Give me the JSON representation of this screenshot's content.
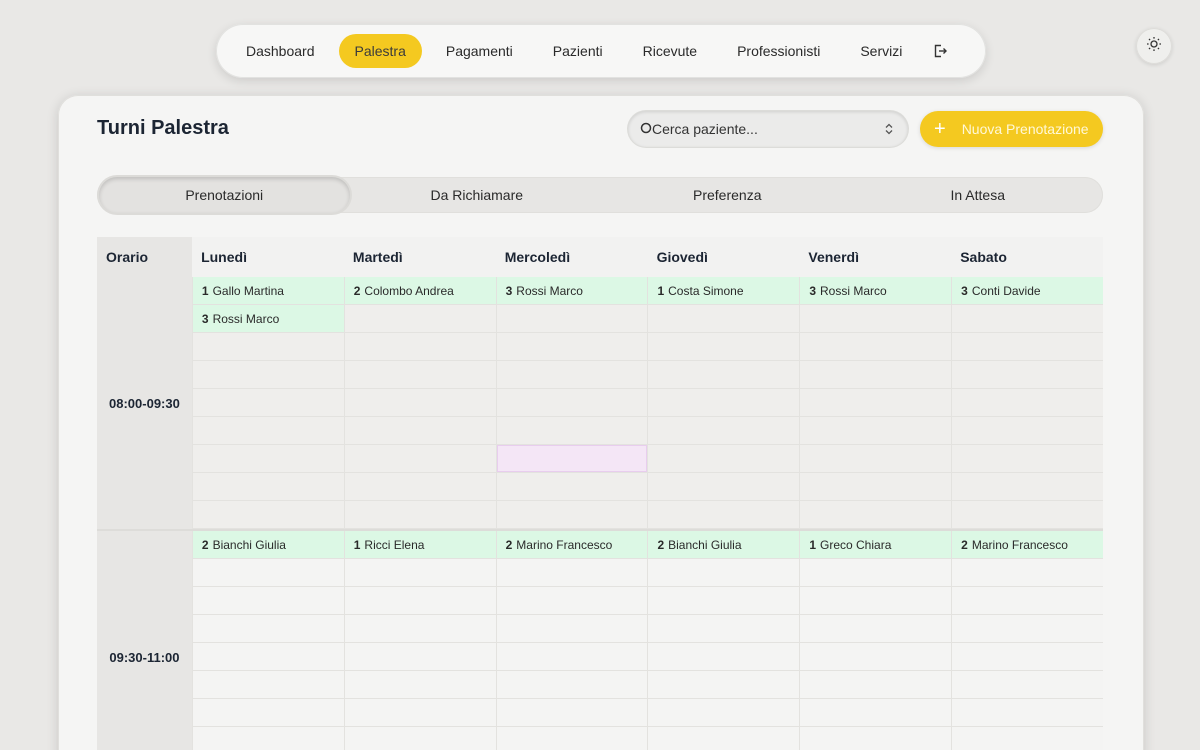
{
  "nav": {
    "items": [
      {
        "label": "Dashboard",
        "active": false
      },
      {
        "label": "Palestra",
        "active": true
      },
      {
        "label": "Pagamenti",
        "active": false
      },
      {
        "label": "Pazienti",
        "active": false
      },
      {
        "label": "Ricevute",
        "active": false
      },
      {
        "label": "Professionisti",
        "active": false
      },
      {
        "label": "Servizi",
        "active": false
      }
    ],
    "logout_icon": "logout-icon"
  },
  "theme_toggle_icon": "sun-icon",
  "page": {
    "title": "Turni Palestra",
    "search_placeholder": "Cerca paziente...",
    "new_button_label": "Nuova Prenotazione",
    "new_button_icon": "plus-icon"
  },
  "tabs": [
    {
      "label": "Prenotazioni",
      "active": true
    },
    {
      "label": "Da Richiamare",
      "active": false
    },
    {
      "label": "Preferenza",
      "active": false
    },
    {
      "label": "In Attesa",
      "active": false
    }
  ],
  "schedule": {
    "time_header": "Orario",
    "days": [
      "Lunedì",
      "Martedì",
      "Mercoledì",
      "Giovedì",
      "Venerdì",
      "Sabato"
    ],
    "blocks": [
      {
        "time": "08:00-09:30",
        "rows": 9,
        "highlight": {
          "day": 2,
          "row": 6
        },
        "bookings": [
          [
            {
              "num": "1",
              "name": "Gallo Martina"
            },
            {
              "num": "3",
              "name": "Rossi Marco"
            }
          ],
          [
            {
              "num": "2",
              "name": "Colombo Andrea"
            }
          ],
          [
            {
              "num": "3",
              "name": "Rossi Marco"
            }
          ],
          [
            {
              "num": "1",
              "name": "Costa Simone"
            }
          ],
          [
            {
              "num": "3",
              "name": "Rossi Marco"
            }
          ],
          [
            {
              "num": "3",
              "name": "Conti Davide"
            }
          ]
        ]
      },
      {
        "time": "09:30-11:00",
        "rows": 9,
        "highlight": null,
        "bookings": [
          [
            {
              "num": "2",
              "name": "Bianchi Giulia"
            }
          ],
          [
            {
              "num": "1",
              "name": "Ricci Elena"
            }
          ],
          [
            {
              "num": "2",
              "name": "Marino Francesco"
            }
          ],
          [
            {
              "num": "2",
              "name": "Bianchi Giulia"
            }
          ],
          [
            {
              "num": "1",
              "name": "Greco Chiara"
            }
          ],
          [
            {
              "num": "2",
              "name": "Marino Francesco"
            }
          ]
        ]
      }
    ]
  },
  "colors": {
    "accent": "#f4c920",
    "booked": "#dcf8e5",
    "highlight": "#f4e6f6"
  }
}
